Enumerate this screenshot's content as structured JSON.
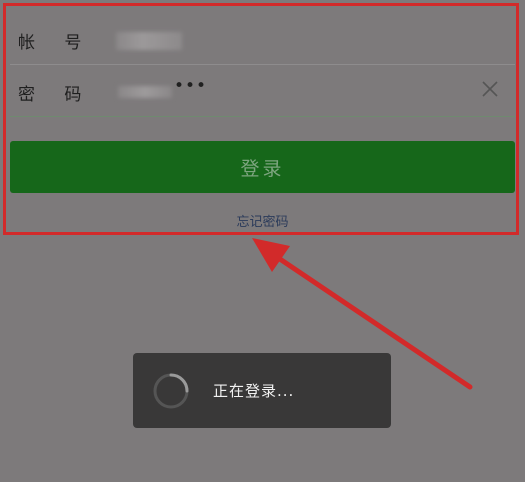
{
  "login_form": {
    "account_label": "帐 号",
    "password_label": "密 码",
    "password_dots": "•••",
    "login_button": "登录",
    "forgot_password": "忘记密码"
  },
  "toast": {
    "message": "正在登录..."
  },
  "colors": {
    "overlay": "#7d7a7b",
    "login_button_bg": "#16671a",
    "login_button_text": "#7da57f",
    "annotation_red": "#d22a2a",
    "toast_bg": "#393838"
  },
  "icons": {
    "clear": "close-icon",
    "loading": "spinner-icon"
  }
}
